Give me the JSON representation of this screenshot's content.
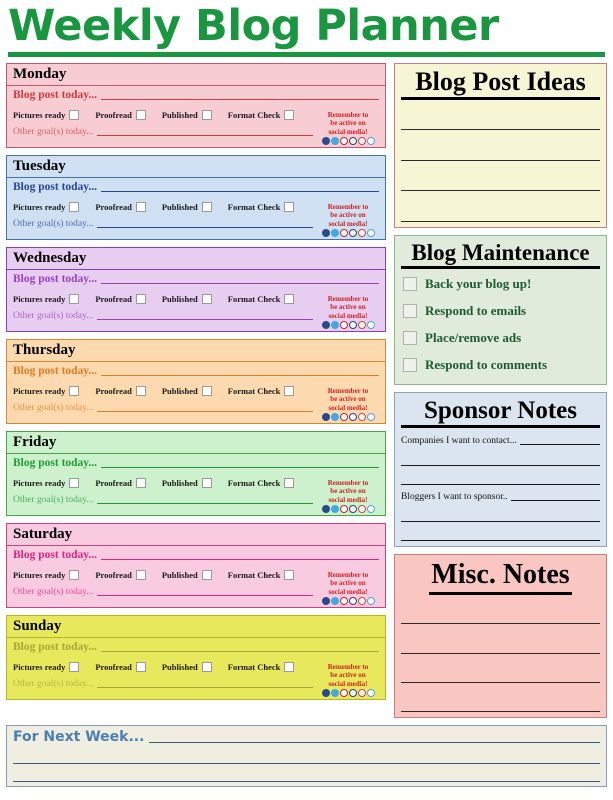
{
  "header": {
    "title": "Weekly Blog Planner",
    "title_color": "#1a9641"
  },
  "day_labels": {
    "blog_post": "Blog post today...",
    "other_goals": "Other goal(s) today...",
    "checks": [
      "Pictures ready",
      "Proofread",
      "Published",
      "Format Check"
    ],
    "social_reminder_line1": "Remember to",
    "social_reminder_line2": "be active on",
    "social_reminder_line3": "social media!",
    "social_icons": [
      "facebook-icon",
      "twitter-icon",
      "pinterest-icon",
      "tumblr-icon",
      "googleplus-icon",
      "rss-icon"
    ],
    "social_icon_colors": [
      "#2b4a8b",
      "#3fa9e0",
      "#cc2127",
      "#2b3f7a",
      "#d8403a",
      "#4aa3df"
    ]
  },
  "days": [
    {
      "name": "Monday",
      "bg": "#f7ccd3",
      "border": "#c2566c",
      "accent": "#d03a3a"
    },
    {
      "name": "Tuesday",
      "bg": "#cfe0f3",
      "border": "#4472a8",
      "accent": "#28459c"
    },
    {
      "name": "Wednesday",
      "bg": "#e7cdf0",
      "border": "#8b3fae",
      "accent": "#9b3fc0"
    },
    {
      "name": "Thursday",
      "bg": "#fcd9ae",
      "border": "#d08a33",
      "accent": "#e07b20"
    },
    {
      "name": "Friday",
      "bg": "#cdf0cd",
      "border": "#44a544",
      "accent": "#1f9b33"
    },
    {
      "name": "Saturday",
      "bg": "#f9cbe0",
      "border": "#c6437f",
      "accent": "#e0218a"
    },
    {
      "name": "Sunday",
      "bg": "#e8e85c",
      "border": "#b5b52a",
      "accent": "#a8a83a"
    }
  ],
  "panels": {
    "ideas": {
      "title": "Blog Post Ideas",
      "bg": "#f6f6d5",
      "line_count": 4
    },
    "maintenance": {
      "title": "Blog Maintenance",
      "bg": "#e0ebdc",
      "items": [
        "Back your blog up!",
        "Respond to emails",
        "Place/remove ads",
        "Respond to comments"
      ]
    },
    "sponsor": {
      "title": "Sponsor Notes",
      "bg": "#dbe5ef",
      "groups": [
        {
          "label": "Companies I want to contact...",
          "line_count": 2
        },
        {
          "label": "Bloggers I want to sponsor..",
          "line_count": 2
        }
      ]
    },
    "misc": {
      "title": "Misc. Notes",
      "bg": "#f9c6c2",
      "line_count": 4
    }
  },
  "footer": {
    "label": "For Next Week...",
    "line_count": 2,
    "color": "#4a7fb5"
  }
}
